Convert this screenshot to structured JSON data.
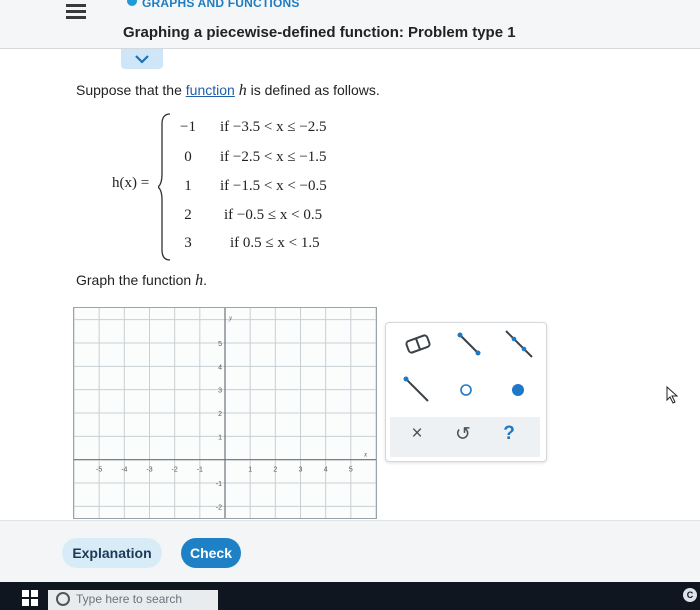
{
  "header": {
    "topic": "GRAPHS AND FUNCTIONS",
    "title": "Graphing a piecewise-defined function: Problem type 1"
  },
  "problem": {
    "intro_before": "Suppose that the ",
    "intro_link": "function",
    "intro_var": "h",
    "intro_after": " is defined as follows.",
    "lhs": "h(x) =",
    "pieces": [
      {
        "value": "−1",
        "condition": "if −3.5 < x ≤ −2.5"
      },
      {
        "value": "0",
        "condition": "if −2.5 < x ≤ −1.5"
      },
      {
        "value": "1",
        "condition": "if −1.5 < x < −0.5"
      },
      {
        "value": "2",
        "condition": "if −0.5 ≤ x < 0.5"
      },
      {
        "value": "3",
        "condition": "if 0.5 ≤ x < 1.5"
      }
    ],
    "graph_prompt": "Graph the function ",
    "graph_var": "h",
    "graph_period": "."
  },
  "graph": {
    "x_ticks": [
      "-5",
      "-4",
      "-3",
      "-2",
      "-1",
      "1",
      "2",
      "3",
      "4",
      "5"
    ],
    "y_ticks": [
      "5",
      "4",
      "3",
      "2",
      "1",
      "-1",
      "-2"
    ],
    "x_label": "x",
    "y_label": "y"
  },
  "toolbox": {
    "tools": [
      "eraser-icon",
      "segment-icon",
      "line-icon",
      "ray-icon",
      "open-point-icon",
      "closed-point-icon"
    ],
    "clear": "×",
    "undo": "↺",
    "help": "?"
  },
  "actions": {
    "explanation": "Explanation",
    "check": "Check"
  },
  "taskbar": {
    "search_placeholder": "Type here to search",
    "tray": "C"
  },
  "colors": {
    "accent": "#1f81c5",
    "topic": "#1f7cc0",
    "tool_blue": "#2a6fb7"
  }
}
